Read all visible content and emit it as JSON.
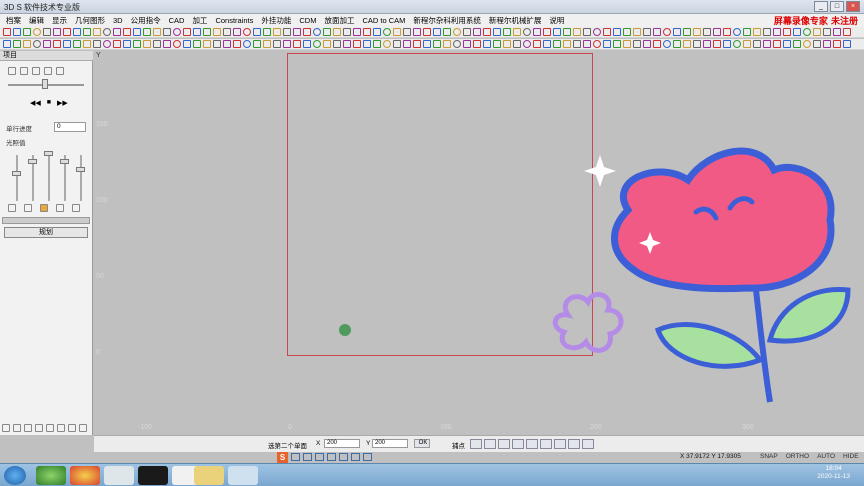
{
  "window": {
    "title": "3D S 软件技术专业版",
    "buttons": [
      "_",
      "□",
      "×"
    ]
  },
  "menu": [
    "档案",
    "编辑",
    "显示",
    "几何图形",
    "3D",
    "公用指令",
    "CAD",
    "加工",
    "Constraints",
    "外挂功能",
    "CDM",
    "放面加工",
    "CAD to CAM",
    "新程尔杂科利用系统",
    "新程尔机械扩展",
    "说明"
  ],
  "watermark": "屏幕录像专家 未注册",
  "left_panel": {
    "header": "项目",
    "label_speed": "单行进度",
    "speed_value": "0",
    "label_light": "光照值",
    "button": "规划"
  },
  "canvas": {
    "y_labels": [
      "150",
      "100",
      "50",
      "0"
    ],
    "x_labels": [
      "-100",
      "0",
      "100",
      "200",
      "300"
    ],
    "y_axis_letter": "Y"
  },
  "status": {
    "prompt": "选第二个单面",
    "x_label": "X",
    "x_value": "200",
    "y_label": "Y",
    "y_value": "200",
    "ok": "OK",
    "snap_label": "捕点"
  },
  "coords": "X 37.9172   Y 17.9305",
  "modes": [
    "SNAP",
    "ORTHO",
    "AUTO",
    "HIDE"
  ],
  "clock": {
    "time": "18:04",
    "date": "2020-11-13"
  },
  "colors": {
    "bed_border": "#c8464e",
    "canvas": "#c0c0c0",
    "flower_fill": "#f25a86",
    "flower_outline": "#3c5fd8",
    "leaf_fill": "#a8e0a0"
  }
}
